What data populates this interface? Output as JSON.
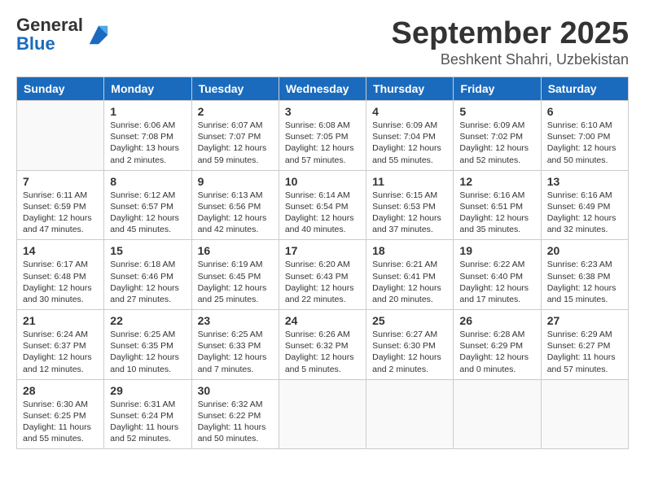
{
  "header": {
    "logo_general": "General",
    "logo_blue": "Blue",
    "title": "September 2025",
    "location": "Beshkent Shahri, Uzbekistan"
  },
  "weekdays": [
    "Sunday",
    "Monday",
    "Tuesday",
    "Wednesday",
    "Thursday",
    "Friday",
    "Saturday"
  ],
  "weeks": [
    [
      {
        "day": "",
        "info": ""
      },
      {
        "day": "1",
        "info": "Sunrise: 6:06 AM\nSunset: 7:08 PM\nDaylight: 13 hours\nand 2 minutes."
      },
      {
        "day": "2",
        "info": "Sunrise: 6:07 AM\nSunset: 7:07 PM\nDaylight: 12 hours\nand 59 minutes."
      },
      {
        "day": "3",
        "info": "Sunrise: 6:08 AM\nSunset: 7:05 PM\nDaylight: 12 hours\nand 57 minutes."
      },
      {
        "day": "4",
        "info": "Sunrise: 6:09 AM\nSunset: 7:04 PM\nDaylight: 12 hours\nand 55 minutes."
      },
      {
        "day": "5",
        "info": "Sunrise: 6:09 AM\nSunset: 7:02 PM\nDaylight: 12 hours\nand 52 minutes."
      },
      {
        "day": "6",
        "info": "Sunrise: 6:10 AM\nSunset: 7:00 PM\nDaylight: 12 hours\nand 50 minutes."
      }
    ],
    [
      {
        "day": "7",
        "info": "Sunrise: 6:11 AM\nSunset: 6:59 PM\nDaylight: 12 hours\nand 47 minutes."
      },
      {
        "day": "8",
        "info": "Sunrise: 6:12 AM\nSunset: 6:57 PM\nDaylight: 12 hours\nand 45 minutes."
      },
      {
        "day": "9",
        "info": "Sunrise: 6:13 AM\nSunset: 6:56 PM\nDaylight: 12 hours\nand 42 minutes."
      },
      {
        "day": "10",
        "info": "Sunrise: 6:14 AM\nSunset: 6:54 PM\nDaylight: 12 hours\nand 40 minutes."
      },
      {
        "day": "11",
        "info": "Sunrise: 6:15 AM\nSunset: 6:53 PM\nDaylight: 12 hours\nand 37 minutes."
      },
      {
        "day": "12",
        "info": "Sunrise: 6:16 AM\nSunset: 6:51 PM\nDaylight: 12 hours\nand 35 minutes."
      },
      {
        "day": "13",
        "info": "Sunrise: 6:16 AM\nSunset: 6:49 PM\nDaylight: 12 hours\nand 32 minutes."
      }
    ],
    [
      {
        "day": "14",
        "info": "Sunrise: 6:17 AM\nSunset: 6:48 PM\nDaylight: 12 hours\nand 30 minutes."
      },
      {
        "day": "15",
        "info": "Sunrise: 6:18 AM\nSunset: 6:46 PM\nDaylight: 12 hours\nand 27 minutes."
      },
      {
        "day": "16",
        "info": "Sunrise: 6:19 AM\nSunset: 6:45 PM\nDaylight: 12 hours\nand 25 minutes."
      },
      {
        "day": "17",
        "info": "Sunrise: 6:20 AM\nSunset: 6:43 PM\nDaylight: 12 hours\nand 22 minutes."
      },
      {
        "day": "18",
        "info": "Sunrise: 6:21 AM\nSunset: 6:41 PM\nDaylight: 12 hours\nand 20 minutes."
      },
      {
        "day": "19",
        "info": "Sunrise: 6:22 AM\nSunset: 6:40 PM\nDaylight: 12 hours\nand 17 minutes."
      },
      {
        "day": "20",
        "info": "Sunrise: 6:23 AM\nSunset: 6:38 PM\nDaylight: 12 hours\nand 15 minutes."
      }
    ],
    [
      {
        "day": "21",
        "info": "Sunrise: 6:24 AM\nSunset: 6:37 PM\nDaylight: 12 hours\nand 12 minutes."
      },
      {
        "day": "22",
        "info": "Sunrise: 6:25 AM\nSunset: 6:35 PM\nDaylight: 12 hours\nand 10 minutes."
      },
      {
        "day": "23",
        "info": "Sunrise: 6:25 AM\nSunset: 6:33 PM\nDaylight: 12 hours\nand 7 minutes."
      },
      {
        "day": "24",
        "info": "Sunrise: 6:26 AM\nSunset: 6:32 PM\nDaylight: 12 hours\nand 5 minutes."
      },
      {
        "day": "25",
        "info": "Sunrise: 6:27 AM\nSunset: 6:30 PM\nDaylight: 12 hours\nand 2 minutes."
      },
      {
        "day": "26",
        "info": "Sunrise: 6:28 AM\nSunset: 6:29 PM\nDaylight: 12 hours\nand 0 minutes."
      },
      {
        "day": "27",
        "info": "Sunrise: 6:29 AM\nSunset: 6:27 PM\nDaylight: 11 hours\nand 57 minutes."
      }
    ],
    [
      {
        "day": "28",
        "info": "Sunrise: 6:30 AM\nSunset: 6:25 PM\nDaylight: 11 hours\nand 55 minutes."
      },
      {
        "day": "29",
        "info": "Sunrise: 6:31 AM\nSunset: 6:24 PM\nDaylight: 11 hours\nand 52 minutes."
      },
      {
        "day": "30",
        "info": "Sunrise: 6:32 AM\nSunset: 6:22 PM\nDaylight: 11 hours\nand 50 minutes."
      },
      {
        "day": "",
        "info": ""
      },
      {
        "day": "",
        "info": ""
      },
      {
        "day": "",
        "info": ""
      },
      {
        "day": "",
        "info": ""
      }
    ]
  ]
}
